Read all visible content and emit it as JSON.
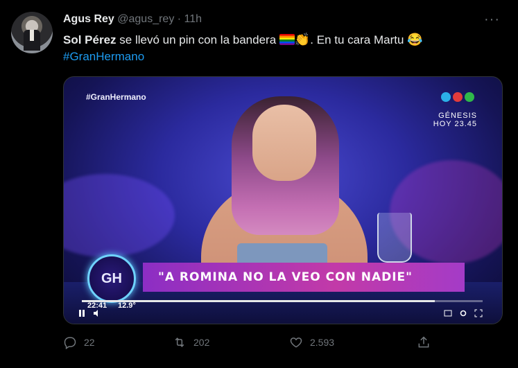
{
  "tweet": {
    "author_name": "Agus Rey",
    "handle": "@agus_rey",
    "separator": "·",
    "time": "11h",
    "more_label": "···",
    "text_mention": "Sol Pérez",
    "text_part1": " se llevó un pin con la bandera ",
    "text_part2": ". En tu cara Martu ",
    "hashtag": "#GranHermano",
    "emoji_clap": "👏",
    "emoji_laugh": "😂"
  },
  "media": {
    "tv_hashtag": "#GranHermano",
    "genesis_title": "GÉNESIS",
    "genesis_sub": "HOY 23.45",
    "gh_logo": "GH",
    "banner_text": "\"A ROMINA NO LA VEO CON NADIE\"",
    "clock_time": "22:41",
    "clock_temp": "12.9°",
    "progress": 0.88,
    "net_colors": [
      "#2bb0e8",
      "#e23b3b",
      "#2fb84a"
    ]
  },
  "actions": {
    "reply_count": "22",
    "retweet_count": "202",
    "like_count": "2.593",
    "icons": [
      "reply-icon",
      "retweet-icon",
      "like-icon",
      "share-icon"
    ]
  }
}
